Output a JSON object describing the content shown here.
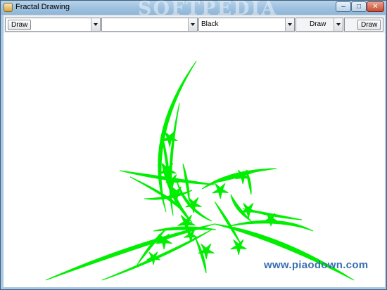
{
  "window": {
    "title": "Fractal Drawing",
    "watermark": "SOFTPEDIA",
    "controls": {
      "minimize": "–",
      "maximize": "□",
      "close": "✕"
    }
  },
  "toolbar": {
    "combo1": {
      "label": "Draw",
      "value": ""
    },
    "combo2": {
      "value": ""
    },
    "combo3": {
      "value": "Black"
    },
    "combo4": {
      "value": "Draw"
    },
    "draw_button": "Draw"
  },
  "canvas": {
    "background": "#ffffff",
    "stroke_color": "#00ee00",
    "site_watermark": "www.piaodown.com"
  }
}
